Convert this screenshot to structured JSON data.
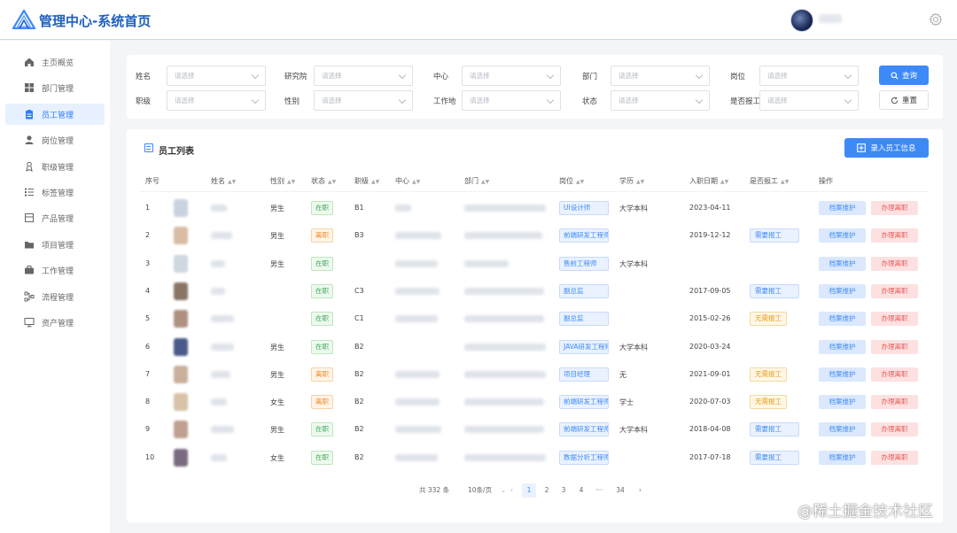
{
  "header": {
    "title": "管理中心-系统首页"
  },
  "sidebar": {
    "items": [
      {
        "label": "主页概览",
        "icon": "home-icon"
      },
      {
        "label": "部门管理",
        "icon": "grid-icon"
      },
      {
        "label": "员工管理",
        "icon": "clipboard-icon",
        "active": true
      },
      {
        "label": "岗位管理",
        "icon": "person-icon"
      },
      {
        "label": "职级管理",
        "icon": "rank-icon"
      },
      {
        "label": "标签管理",
        "icon": "tag-list-icon"
      },
      {
        "label": "产品管理",
        "icon": "product-icon"
      },
      {
        "label": "项目管理",
        "icon": "folder-icon"
      },
      {
        "label": "工作管理",
        "icon": "briefcase-icon"
      },
      {
        "label": "流程管理",
        "icon": "flow-icon"
      },
      {
        "label": "资产管理",
        "icon": "monitor-icon"
      }
    ]
  },
  "filters": {
    "placeholder": "请选择",
    "row1": [
      "姓名",
      "研究院",
      "中心",
      "部门",
      "岗位"
    ],
    "row2": [
      "职级",
      "性别",
      "工作地",
      "状态",
      "是否报工"
    ],
    "query_label": "查询",
    "reset_label": "重置"
  },
  "list": {
    "title": "员工列表",
    "import_label": "录入员工信息",
    "columns": [
      "序号",
      "姓名",
      "性别",
      "状态",
      "职级",
      "中心",
      "部门",
      "岗位",
      "学历",
      "入职日期",
      "是否报工",
      "操作"
    ],
    "archive_label": "档案维护",
    "leave_label": "办理离职",
    "rows": [
      {
        "no": "1",
        "gender": "男生",
        "status": "在职",
        "st": "green",
        "level": "B1",
        "post": "UI设计师",
        "edu": "大学本科",
        "date": "2023-04-11",
        "report": "",
        "rt": ""
      },
      {
        "no": "2",
        "gender": "男生",
        "status": "离职",
        "st": "orange",
        "level": "B3",
        "post": "前端研发工程师",
        "edu": "",
        "date": "2019-12-12",
        "report": "需要报工",
        "rt": "blue"
      },
      {
        "no": "3",
        "gender": "男生",
        "status": "在职",
        "st": "green",
        "level": "",
        "post": "售前工程师",
        "edu": "大学本科",
        "date": "",
        "report": "",
        "rt": ""
      },
      {
        "no": "4",
        "gender": "",
        "status": "在职",
        "st": "green",
        "level": "C3",
        "post": "副总监",
        "edu": "",
        "date": "2017-09-05",
        "report": "需要报工",
        "rt": "blue"
      },
      {
        "no": "5",
        "gender": "",
        "status": "在职",
        "st": "green",
        "level": "C1",
        "post": "副总监",
        "edu": "",
        "date": "2015-02-26",
        "report": "无需报工",
        "rt": "yellow"
      },
      {
        "no": "6",
        "gender": "男生",
        "status": "在职",
        "st": "green",
        "level": "B2",
        "post": "JAVA研发工程师",
        "edu": "大学本科",
        "date": "2020-03-24",
        "report": "",
        "rt": ""
      },
      {
        "no": "7",
        "gender": "男生",
        "status": "离职",
        "st": "orange",
        "level": "B2",
        "post": "项目经理",
        "edu": "无",
        "date": "2021-09-01",
        "report": "无需报工",
        "rt": "yellow"
      },
      {
        "no": "8",
        "gender": "女生",
        "status": "离职",
        "st": "orange",
        "level": "B2",
        "post": "前端研发工程师",
        "edu": "学士",
        "date": "2020-07-03",
        "report": "无需报工",
        "rt": "yellow"
      },
      {
        "no": "9",
        "gender": "男生",
        "status": "在职",
        "st": "green",
        "level": "B2",
        "post": "前端研发工程师",
        "edu": "大学本科",
        "date": "2018-04-08",
        "report": "需要报工",
        "rt": "blue"
      },
      {
        "no": "10",
        "gender": "女生",
        "status": "在职",
        "st": "green",
        "level": "B2",
        "post": "数据分析工程师",
        "edu": "",
        "date": "2017-07-18",
        "report": "需要报工",
        "rt": "blue"
      }
    ]
  },
  "pagination": {
    "total": "共 332 条",
    "page_size": "10条/页",
    "pages": [
      "1",
      "2",
      "3",
      "4",
      "···",
      "34"
    ],
    "current": "1"
  },
  "watermark": "@稀土掘金技术社区",
  "colors": {
    "primary": "#3d8af7",
    "brand": "#1f5fbf",
    "danger": "#e85a5a"
  }
}
